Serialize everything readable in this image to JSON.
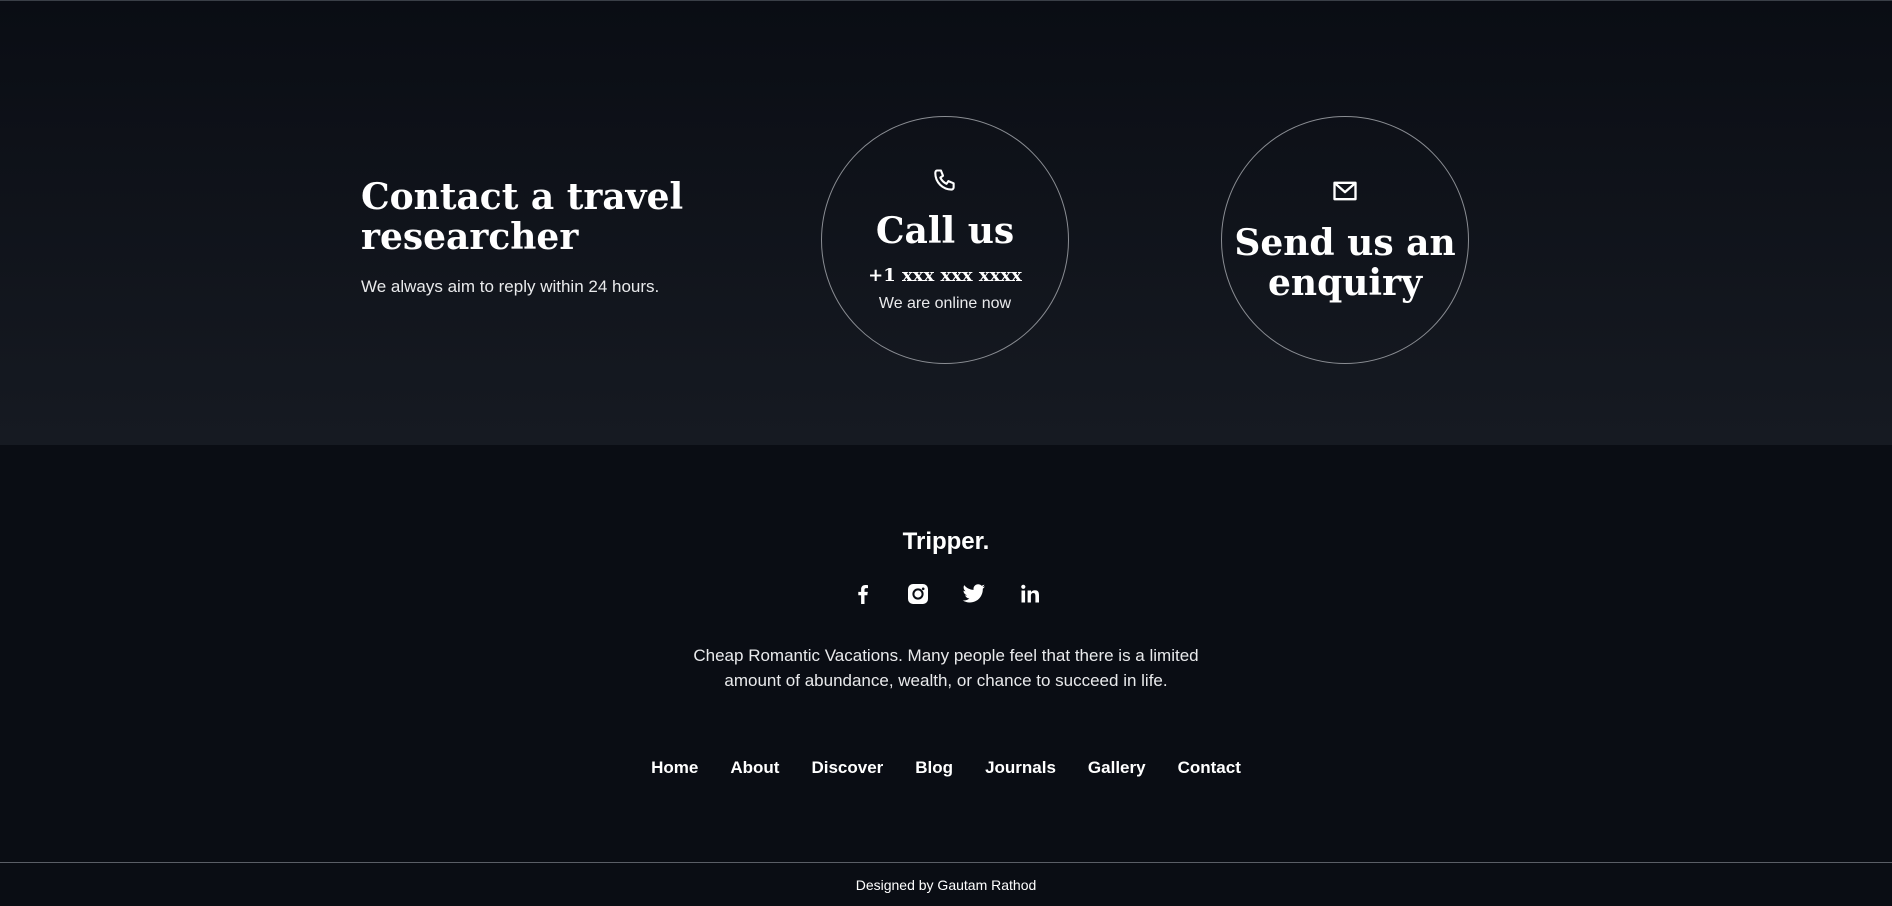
{
  "contact": {
    "title": "Contact a travel researcher",
    "subtitle": "We always aim to reply within 24 hours.",
    "call": {
      "icon": "phone-icon",
      "title": "Call us",
      "phone": "+1 xxx xxx xxxx",
      "status": "We are online now"
    },
    "enquiry": {
      "icon": "mail-icon",
      "title": "Send us an enquiry"
    }
  },
  "footer": {
    "brand": "Tripper.",
    "socials": [
      {
        "icon": "facebook-icon"
      },
      {
        "icon": "instagram-icon"
      },
      {
        "icon": "twitter-icon"
      },
      {
        "icon": "linkedin-icon"
      }
    ],
    "tagline": "Cheap Romantic Vacations. Many people feel that there is a limited amount of abundance, wealth, or chance to succeed in life.",
    "nav": [
      "Home",
      "About",
      "Discover",
      "Blog",
      "Journals",
      "Gallery",
      "Contact"
    ],
    "credit": "Designed by Gautam Rathod"
  },
  "colors": {
    "background": "#0a0d14",
    "section_bottom": "#161a22",
    "circle_border": "#8a8d93",
    "text": "#ffffff"
  }
}
